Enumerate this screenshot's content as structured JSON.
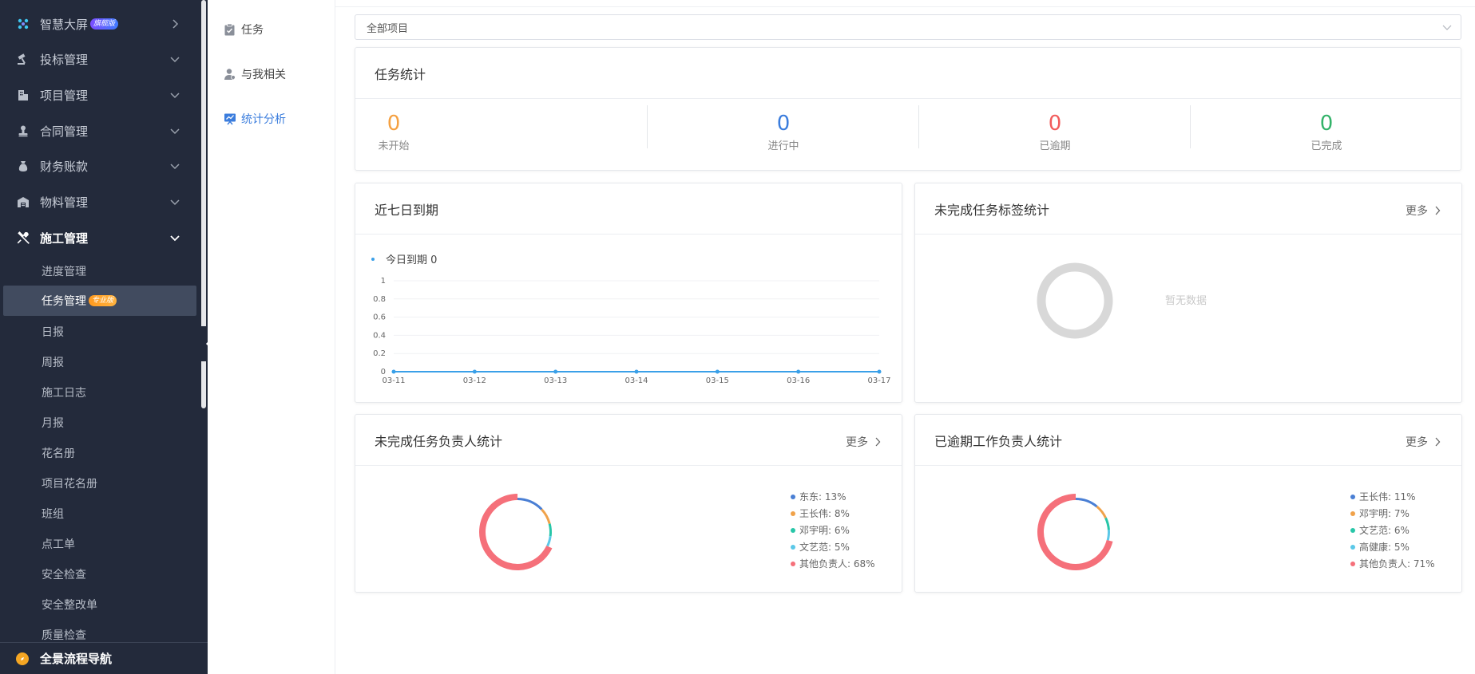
{
  "sidebar": {
    "smart_screen": {
      "label": "智慧大屏",
      "badge": "旗舰版"
    },
    "menus": [
      {
        "label": "投标管理",
        "icon": "gavel-icon"
      },
      {
        "label": "项目管理",
        "icon": "building-icon"
      },
      {
        "label": "合同管理",
        "icon": "stamp-icon"
      },
      {
        "label": "财务账款",
        "icon": "money-bag-icon"
      },
      {
        "label": "物料管理",
        "icon": "warehouse-icon"
      }
    ],
    "construction": {
      "label": "施工管理",
      "icon": "tools-icon"
    },
    "sub_items": [
      {
        "label": "进度管理"
      },
      {
        "label": "任务管理",
        "badge": "专业版"
      },
      {
        "label": "日报"
      },
      {
        "label": "周报"
      },
      {
        "label": "施工日志"
      },
      {
        "label": "月报"
      },
      {
        "label": "花名册"
      },
      {
        "label": "项目花名册"
      },
      {
        "label": "班组"
      },
      {
        "label": "点工单"
      },
      {
        "label": "安全检查"
      },
      {
        "label": "安全整改单"
      },
      {
        "label": "质量检查"
      }
    ],
    "footer": {
      "label": "全景流程导航"
    }
  },
  "subnav": {
    "items": [
      {
        "label": "任务"
      },
      {
        "label": "与我相关"
      },
      {
        "label": "统计分析"
      }
    ],
    "active_color": "#3b7ddd"
  },
  "project_select": {
    "value": "全部项目"
  },
  "task_stats": {
    "title": "任务统计",
    "items": [
      {
        "value": "0",
        "label": "未开始",
        "color": "#f5a142"
      },
      {
        "value": "0",
        "label": "进行中",
        "color": "#3b7ddd"
      },
      {
        "value": "0",
        "label": "已逾期",
        "color": "#f25c5c"
      },
      {
        "value": "0",
        "label": "已完成",
        "color": "#34b36a"
      }
    ]
  },
  "due_7days": {
    "title": "近七日到期",
    "legend_label": "今日到期 0"
  },
  "tag_stats": {
    "title": "未完成任务标签统计",
    "more": "更多",
    "empty_text": "暂无数据"
  },
  "owner_stats": {
    "title": "未完成任务负责人统计",
    "more": "更多"
  },
  "overdue_stats": {
    "title": "已逾期工作负责人统计",
    "more": "更多"
  },
  "chart_data": [
    {
      "type": "line",
      "title": "近七日到期",
      "x": [
        "03-11",
        "03-12",
        "03-13",
        "03-14",
        "03-15",
        "03-16",
        "03-17"
      ],
      "series": [
        {
          "name": "今日到期",
          "values": [
            0,
            0,
            0,
            0,
            0,
            0,
            0
          ]
        }
      ],
      "yticks": [
        "0",
        "0.2",
        "0.4",
        "0.6",
        "0.8",
        "1"
      ],
      "ylim": [
        0,
        1
      ],
      "color": "#3aa0e8",
      "grid": true,
      "legend": "top-left"
    },
    {
      "type": "pie",
      "title": "未完成任务负责人统计",
      "slices": [
        {
          "name": "东东",
          "value": 13,
          "text": "东东: 13%",
          "color": "#4a7fd4"
        },
        {
          "name": "王长伟",
          "value": 8,
          "text": "王长伟: 8%",
          "color": "#f0a24a"
        },
        {
          "name": "邓宇明",
          "value": 6,
          "text": "邓宇明: 6%",
          "color": "#27c6a8"
        },
        {
          "name": "文艺范",
          "value": 5,
          "text": "文艺范: 5%",
          "color": "#5bc8e8"
        },
        {
          "name": "其他负责人",
          "value": 68,
          "text": "其他负责人: 68%",
          "color": "#f5707a"
        }
      ],
      "legend": "right"
    },
    {
      "type": "pie",
      "title": "已逾期工作负责人统计",
      "slices": [
        {
          "name": "王长伟",
          "value": 11,
          "text": "王长伟: 11%",
          "color": "#4a7fd4"
        },
        {
          "name": "邓宇明",
          "value": 7,
          "text": "邓宇明: 7%",
          "color": "#f0a24a"
        },
        {
          "name": "文艺范",
          "value": 6,
          "text": "文艺范: 6%",
          "color": "#27c6a8"
        },
        {
          "name": "高健康",
          "value": 5,
          "text": "高健康: 5%",
          "color": "#5bc8e8"
        },
        {
          "name": "其他负责人",
          "value": 71,
          "text": "其他负责人: 71%",
          "color": "#f5707a"
        }
      ],
      "legend": "right"
    }
  ]
}
